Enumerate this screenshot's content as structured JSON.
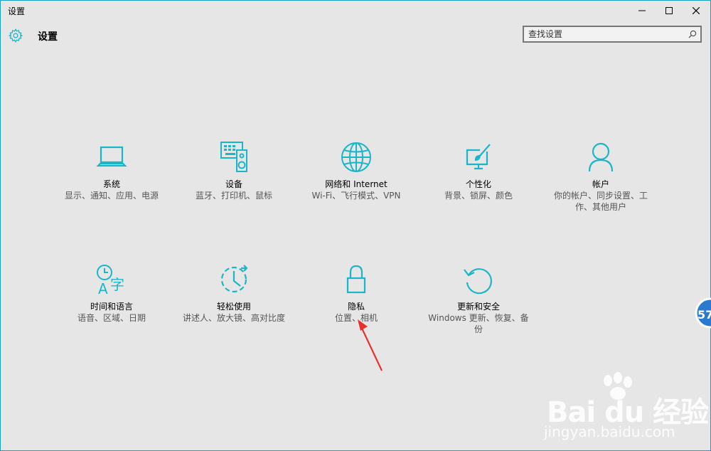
{
  "window": {
    "title": "设置"
  },
  "header": {
    "title": "设置"
  },
  "search": {
    "placeholder": "查找设置"
  },
  "colors": {
    "accent": "#1ab6c8",
    "arrow": "#e8302c"
  },
  "tiles": [
    {
      "icon": "laptop-icon",
      "name": "系统",
      "desc": "显示、通知、应用、电源"
    },
    {
      "icon": "keyboard-speaker-icon",
      "name": "设备",
      "desc": "蓝牙、打印机、鼠标"
    },
    {
      "icon": "globe-icon",
      "name": "网络和 Internet",
      "desc": "Wi-Fi、飞行模式、VPN"
    },
    {
      "icon": "paint-icon",
      "name": "个性化",
      "desc": "背景、锁屏、颜色"
    },
    {
      "icon": "person-icon",
      "name": "帐户",
      "desc": "你的帐户、同步设置、工作、其他用户"
    },
    {
      "icon": "time-language-icon",
      "name": "时间和语言",
      "desc": "语音、区域、日期"
    },
    {
      "icon": "ease-of-access-icon",
      "name": "轻松使用",
      "desc": "讲述人、放大镜、高对比度"
    },
    {
      "icon": "lock-icon",
      "name": "隐私",
      "desc": "位置、相机"
    },
    {
      "icon": "refresh-icon",
      "name": "更新和安全",
      "desc": "Windows 更新、恢复、备份"
    }
  ],
  "watermark": {
    "logo": "Bai du 经验",
    "url": "jingyan.baidu.com"
  },
  "badge": {
    "text": "57"
  }
}
